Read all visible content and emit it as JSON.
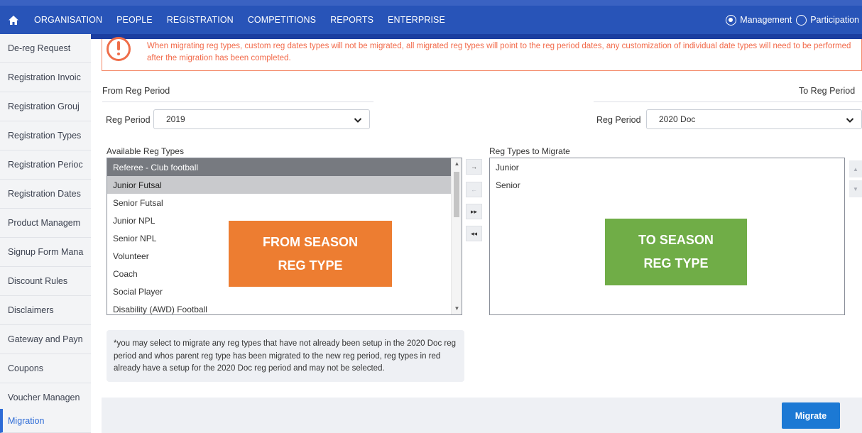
{
  "topnav": {
    "home_icon": "home-icon",
    "items": [
      "ORGANISATION",
      "PEOPLE",
      "REGISTRATION",
      "COMPETITIONS",
      "REPORTS",
      "ENTERPRISE"
    ],
    "mode_options": [
      {
        "label": "Management",
        "selected": true
      },
      {
        "label": "Participation",
        "selected": false
      }
    ]
  },
  "sidebar": {
    "items": [
      "De-reg Request",
      "Registration Invoic",
      "Registration Grouj",
      "Registration Types",
      "Registration Perioc",
      "Registration Dates",
      "Product Managem",
      "Signup Form Mana",
      "Discount Rules",
      "Disclaimers",
      "Gateway and Payn",
      "Coupons",
      "Voucher Managen",
      "Migration"
    ],
    "active": "Migration"
  },
  "alert": {
    "icon": "exclamation-circle-icon",
    "text": "When migrating reg types, custom reg dates types will not be migrated, all migrated reg types will point to the reg period dates, any customization of individual date types will need to be performed after the migration has been completed."
  },
  "from": {
    "section_label": "From Reg Period",
    "field_label": "Reg Period",
    "selected": "2019",
    "list_label": "Available Reg Types",
    "items": [
      "Referee - Club football",
      "Junior Futsal",
      "Senior Futsal",
      "Junior NPL",
      "Senior NPL",
      "Volunteer",
      "Coach",
      "Social Player",
      "Disability (AWD) Football"
    ]
  },
  "to": {
    "section_label": "To Reg Period",
    "field_label": "Reg Period",
    "selected": "2020 Doc",
    "list_label": "Reg Types to Migrate",
    "items": [
      "Junior",
      "Senior"
    ]
  },
  "move_buttons": {
    "add": "→",
    "remove": "←",
    "add_all": "▸▸",
    "remove_all": "◂◂"
  },
  "overlays": {
    "from_line1": "FROM SEASON",
    "from_line2": "REG TYPE",
    "to_line1": "TO SEASON",
    "to_line2": "REG TYPE",
    "from_color": "#ed7d31",
    "to_color": "#70ad47"
  },
  "note": "*you may select to migrate any reg types that have not already been setup in the 2020 Doc reg period and whos parent reg type has been migrated to the new reg period, reg types in red already have a setup for the 2020 Doc reg period and may not be selected.",
  "actions": {
    "migrate_label": "Migrate"
  },
  "colors": {
    "nav_bg": "#2854b8",
    "accent": "#1c79d4",
    "alert": "#f26a4a"
  }
}
